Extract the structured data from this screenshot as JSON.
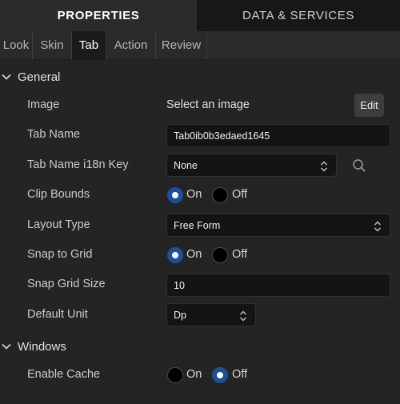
{
  "top_tabs": [
    "PROPERTIES",
    "DATA & SERVICES"
  ],
  "sub_tabs": [
    "Look",
    "Skin",
    "Tab",
    "Action",
    "Review"
  ],
  "sections": {
    "general": "General",
    "windows": "Windows"
  },
  "rows": {
    "image": {
      "label": "Image",
      "value": "Select an image",
      "button": "Edit"
    },
    "tab_name": {
      "label": "Tab Name",
      "value": "Tab0ib0b3edaed1645"
    },
    "tab_name_key": {
      "label": "Tab Name i18n Key",
      "value": "None"
    },
    "clip_bounds": {
      "label": "Clip Bounds",
      "selected": "On"
    },
    "layout_type": {
      "label": "Layout Type",
      "value": "Free Form"
    },
    "snap_to_grid": {
      "label": "Snap to Grid",
      "selected": "On"
    },
    "snap_grid_size": {
      "label": "Snap Grid Size",
      "value": "10"
    },
    "default_unit": {
      "label": "Default Unit",
      "value": "Dp"
    },
    "enable_cache": {
      "label": "Enable Cache",
      "selected": "Off"
    }
  },
  "radio_labels": {
    "on": "On",
    "off": "Off"
  },
  "icons": {
    "section_toggle": "chevron-down-icon",
    "select_arrows": "chevron-up-down-icon",
    "search": "search-icon"
  },
  "colors": {
    "active_radio": "#1f4f9a",
    "panel_bg": "#242424",
    "field_bg": "#141414"
  }
}
